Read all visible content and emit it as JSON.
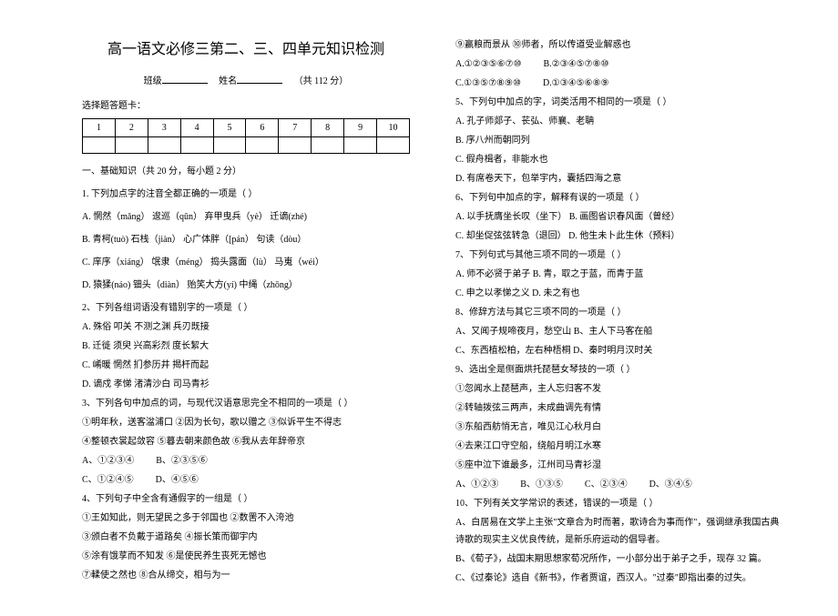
{
  "header": {
    "title": "高一语文必修三第二、三、四单元知识检测",
    "class_label": "班级",
    "name_label": "姓名",
    "score_label": "（共 112 分）",
    "card_label": "选择题答题卡：",
    "grid_cells": [
      "1",
      "2",
      "3",
      "4",
      "5",
      "6",
      "7",
      "8",
      "9",
      "10"
    ]
  },
  "left": {
    "sec1": "一、基础知识（共 20 分，每小题 2 分）",
    "q1": "1. 下列加点字的注音全都正确的一项是（  ）",
    "q1a": "A. 惘然（mǎng）    逡巡（qūn）    弃甲曳兵（yè）       迁谪(zhé)",
    "q1b": "B. 青柯(tuò)      石栈（jiàn）     心广体胖（[pán）     句读（dòu）",
    "q1c": "C. 庠序（xiáng）  氓隶（méng）   捣头露面（lù）        马嵬（wéi）",
    "q1d": "D. 猿猱(náo)      钿头（diàn）   贻笑大方(yí)          中绳（zhōng）",
    "q2": "2、下列各组词语没有错别字的一项是（  ）",
    "q2a": "A. 殊俗    叩关    不测之渊    兵刃既接",
    "q2b": "B. 迁徙    须臾    兴高彩烈    度长絜大",
    "q2c": "C. 崤暖    惘然    扪参历井    揭杆而起",
    "q2d": "D. 谪戍    孝悌    渚清沙白    司马青衫",
    "q3": "3、下列各句中加点的词，与现代汉语意思完全不相同的一项是（    ）",
    "q3circ": "①明年秋，送客湓浦口  ②因为长句，歌以赠之  ③似诉平生不得志",
    "q3circ2": "④整顿衣裳起敛容  ⑤暮去朝来颜色故  ⑥我从去年辞帝京",
    "q3opts": {
      "a": "A、①②③④",
      "b": "B、②③⑤⑥",
      "c": "C、①②④⑤",
      "d": "D、④⑤⑥"
    },
    "q4": "4、下列句子中全含有通假字的一组是（      ）",
    "q4l1": "①王如知此，则无望民之多于邻国也        ②数罟不入洿池",
    "q4l2": "③颁白者不负戴于道路矣                    ④振长策而御宇内",
    "q4l3": "⑤涂有饿莩而不知发                        ⑥是使民养生丧死无憾也",
    "q4l4": "⑦輮使之然也                              ⑧合从缔交，相与为一"
  },
  "right": {
    "r0a": "⑨赢粮而景从                              ⑩师者，所以传道受业解惑也",
    "r0opts": {
      "a": "A.①②③⑤⑥⑦⑩",
      "b": "B.②③④⑤⑦⑧⑩",
      "c": "C.①③⑤⑦⑧⑨⑩",
      "d": "D.①③④⑤⑥⑧⑨"
    },
    "q5": "5、下列句中加点的字，词类活用不相同的一项是（  ）",
    "q5a": "A. 孔子师郯子、苌弘、师襄、老聃",
    "q5b": "B. 序八州而朝同列",
    "q5c": "C. 假舟楫者，非能水也",
    "q5d": "D. 有席卷天下，包举宇内，囊括四海之意",
    "q6": "6、下列句中加点的字，解释有误的一项是（  ）",
    "q6a": "A. 以手抚膺坐长叹（坐下）    B. 画图省识春风面（曾经）",
    "q6b": "C. 却坐促弦弦转急（退回）    D. 他生未卜此生休（预料）",
    "q7": "7、下列句式与其他三项不同的一项是（  ）",
    "q7a": "A. 师不必贤于弟子        B. 青，取之于蓝，而青于蓝",
    "q7b": "C. 申之以孝悌之义        D. 未之有也",
    "q8": "8、修辞方法与其它三项不同的一项是（    ）",
    "q8a": "A、又闻子规啼夜月，愁空山        B、主人下马客在船",
    "q8b": "C、东西植松柏，左右种梧桐        D、秦时明月汉时关",
    "q9": "9、选出全是侧面烘托琵琶女琴技的一项（  ）",
    "q9l1": "①忽闻水上琵琶声，主人忘归客不发",
    "q9l2": "②转轴拨弦三两声，未成曲调先有情",
    "q9l3": "③东船西舫悄无言，唯见江心秋月白",
    "q9l4": "④去来江口守空船，绕船月明江水寒",
    "q9l5": "⑤座中泣下谁最多，江州司马青衫湿",
    "q9opts": {
      "a": "A、①②③",
      "b": "B、①③⑤",
      "c": "C、②③④",
      "d": "D、③④⑤"
    },
    "q10": "10、下列有关文学常识的表述，错误的一项是（   ）",
    "q10a": "A、白居易在文学上主张\"文章合为时而著，歌诗合为事而作\"，强调继承我国古典诗歌的现实主义优良传统，是新乐府运动的倡导者。",
    "q10b": "B、《荀子》，战国末期思想家荀况所作，一小部分出于弟子之手，现存 32 篇。",
    "q10c": "C、《过秦论》选自《新书》，作者贾谊，西汉人。\"过秦\"即指出秦的过失。"
  }
}
